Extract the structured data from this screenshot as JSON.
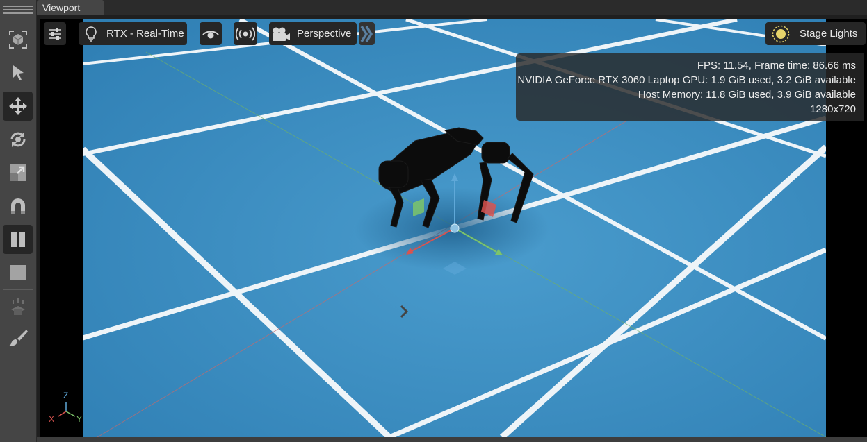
{
  "tab": {
    "title": "Viewport"
  },
  "toolbar": {
    "tools": [
      {
        "name": "select-mode",
        "icon": "cube-select-icon"
      },
      {
        "name": "select",
        "icon": "arrow-pointer-icon"
      },
      {
        "name": "move",
        "icon": "move-arrows-icon",
        "active": true
      },
      {
        "name": "rotate",
        "icon": "rotate-icon"
      },
      {
        "name": "scale",
        "icon": "scale-icon"
      },
      {
        "name": "snap",
        "icon": "magnet-icon"
      },
      {
        "name": "pause",
        "icon": "pause-icon",
        "active": true
      },
      {
        "name": "stop",
        "icon": "stop-icon"
      },
      {
        "name": "physics",
        "icon": "physics-icon"
      },
      {
        "name": "paint",
        "icon": "paint-brush-icon"
      }
    ]
  },
  "viewport_controls": {
    "settings_icon": "sliders-icon",
    "renderer_label": "RTX - Real-Time",
    "renderer_icon": "lightbulb-icon",
    "visibility_icon": "eye-icon",
    "sensor_icon": "broadcast-icon",
    "camera_label": "Perspective",
    "camera_icon": "camera-icon",
    "more_icon": "double-chevron-right-icon",
    "lights_label": "Stage Lights",
    "lights_icon": "sun-icon"
  },
  "stats": {
    "fps": "FPS: 11.54, Frame time: 86.66 ms",
    "gpu": "NVIDIA GeForce RTX 3060 Laptop GPU: 1.9 GiB used, 3.2 GiB available",
    "host": "Host Memory: 11.8 GiB used, 3.9 GiB available",
    "resolution": "1280x720"
  },
  "axes": {
    "x": "X",
    "y": "Y",
    "z": "Z"
  },
  "colors": {
    "floor": "#3f8fc2",
    "gridline": "#f2f6f8",
    "axis_x": "#d9534f",
    "axis_y": "#7dc46a",
    "axis_z": "#5fa8d8",
    "panel": "#454545"
  }
}
